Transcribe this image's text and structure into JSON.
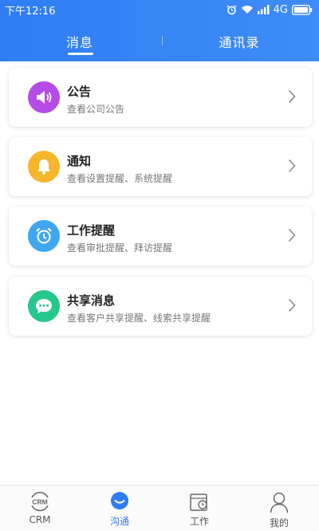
{
  "status_bar": {
    "time": "下午12:16",
    "network": "4G"
  },
  "tabs": [
    {
      "label": "消息",
      "active": true
    },
    {
      "label": "通讯录",
      "active": false
    }
  ],
  "cards": [
    {
      "title": "公告",
      "subtitle": "查看公司公告",
      "icon": "speaker-icon",
      "color": "#b64be8"
    },
    {
      "title": "通知",
      "subtitle": "查看设置提醒、系统提醒",
      "icon": "bell-icon",
      "color": "#f7b52b"
    },
    {
      "title": "工作提醒",
      "subtitle": "查看审批提醒、拜访提醒",
      "icon": "alarm-clock-icon",
      "color": "#3fa7f2"
    },
    {
      "title": "共享消息",
      "subtitle": "查看客户共享提醒、线索共享提醒",
      "icon": "chat-bubble-icon",
      "color": "#25c78d"
    }
  ],
  "tabbar": [
    {
      "label": "CRM",
      "icon": "crm-icon",
      "active": false
    },
    {
      "label": "沟通",
      "icon": "chat-icon",
      "active": true
    },
    {
      "label": "工作",
      "icon": "work-calendar-icon",
      "active": false
    },
    {
      "label": "我的",
      "icon": "profile-icon",
      "active": false
    }
  ],
  "colors": {
    "header": "#2f7df3",
    "active_tab": "#2f7df3"
  }
}
